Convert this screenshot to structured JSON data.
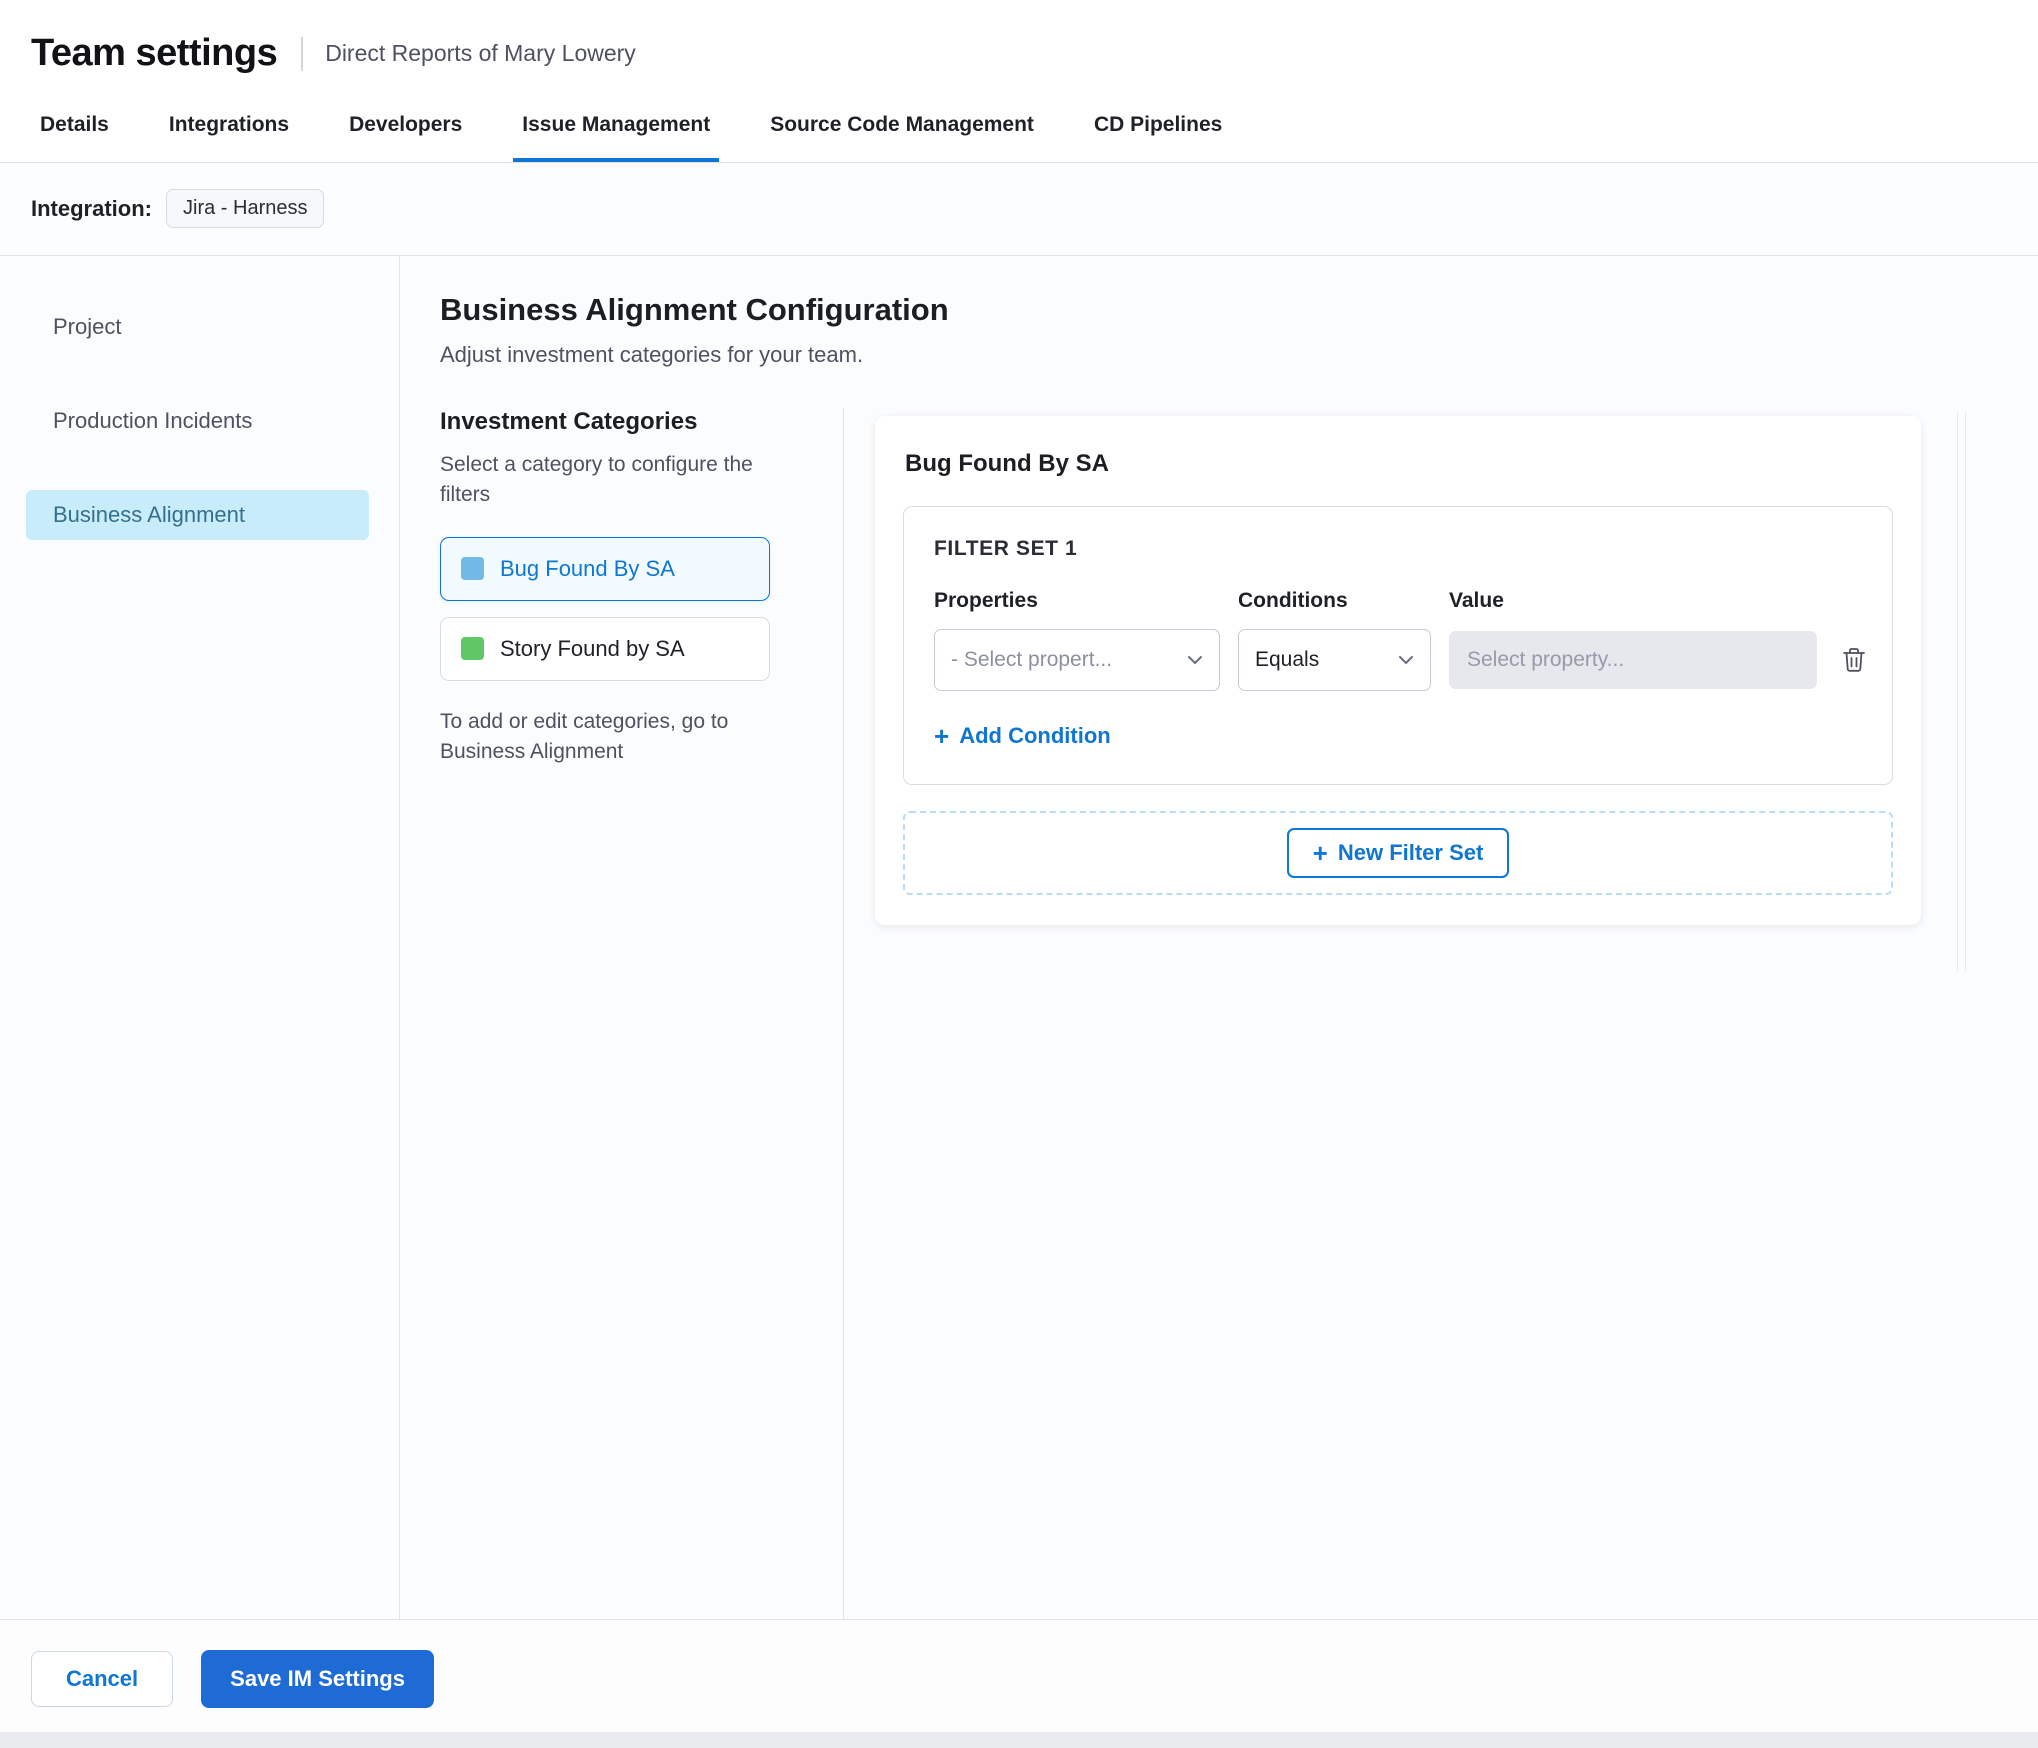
{
  "header": {
    "title": "Team settings",
    "subtitle": "Direct Reports of Mary Lowery"
  },
  "tabs": [
    {
      "label": "Details",
      "active": false
    },
    {
      "label": "Integrations",
      "active": false
    },
    {
      "label": "Developers",
      "active": false
    },
    {
      "label": "Issue Management",
      "active": true
    },
    {
      "label": "Source Code Management",
      "active": false
    },
    {
      "label": "CD Pipelines",
      "active": false
    }
  ],
  "integration": {
    "label": "Integration:",
    "chip": "Jira - Harness"
  },
  "sidebar": {
    "items": [
      {
        "label": "Project",
        "active": false
      },
      {
        "label": "Production Incidents",
        "active": false
      },
      {
        "label": "Business Alignment",
        "active": true
      }
    ]
  },
  "main": {
    "title": "Business Alignment Configuration",
    "subtitle": "Adjust investment categories for your team.",
    "categories": {
      "title": "Investment Categories",
      "hint": "Select a category to configure the filters",
      "items": [
        {
          "label": "Bug Found By SA",
          "color": "#72b9e5",
          "selected": true
        },
        {
          "label": "Story Found by SA",
          "color": "#5fc763",
          "selected": false
        }
      ],
      "footnote": "To add or edit categories, go to Business Alignment"
    },
    "panel": {
      "title": "Bug Found By SA",
      "filter_set": {
        "title": "FILTER SET 1",
        "columns": [
          "Properties",
          "Conditions",
          "Value"
        ],
        "property_placeholder": "- Select propert...",
        "condition_value": "Equals",
        "value_placeholder": "Select property...",
        "add_condition_label": "Add Condition"
      },
      "new_filter_set_label": "New Filter Set"
    }
  },
  "footer": {
    "cancel_label": "Cancel",
    "save_label": "Save IM Settings"
  },
  "icons": {
    "plus": "+",
    "trash": "trash-icon",
    "chevron": "chevron-down-icon"
  },
  "colors": {
    "accent": "#0f76d3",
    "save_button": "#1f6bd6",
    "nav_selected_bg": "#c9ecfa",
    "category_selected_bg": "#f1fbff"
  }
}
